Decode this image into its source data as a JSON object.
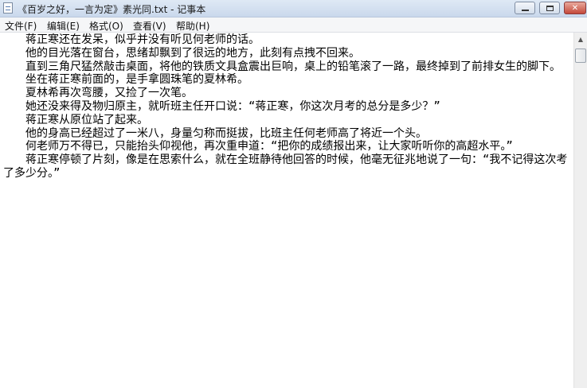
{
  "window": {
    "title": "《百岁之好，一言为定》素光同.txt - 记事本"
  },
  "menubar": {
    "items": [
      {
        "label": "文件(F)"
      },
      {
        "label": "编辑(E)"
      },
      {
        "label": "格式(O)"
      },
      {
        "label": "查看(V)"
      },
      {
        "label": "帮助(H)"
      }
    ]
  },
  "editor": {
    "content": "　　蒋正寒还在发呆，似乎并没有听见何老师的话。\n　　他的目光落在窗台，思绪却飘到了很远的地方，此刻有点拽不回来。\n　　直到三角尺猛然敲击桌面，将他的铁质文具盒震出巨响，桌上的铅笔滚了一路，最终掉到了前排女生的脚下。\n　　坐在蒋正寒前面的，是手拿圆珠笔的夏林希。\n　　夏林希再次弯腰，又捡了一次笔。\n　　她还没来得及物归原主，就听班主任开口说：“蒋正寒，你这次月考的总分是多少？”\n　　蒋正寒从原位站了起来。\n　　他的身高已经超过了一米八，身量匀称而挺拔，比班主任何老师高了将近一个头。\n　　何老师万不得已，只能抬头仰视他，再次重申道：“把你的成绩报出来，让大家听听你的高超水平。”\n　　蒋正寒停顿了片刻，像是在思索什么，就在全班静待他回答的时候，他毫无征兆地说了一句：“我不记得这次考了多少分。”"
  },
  "icons": {
    "app": "notepad-icon",
    "minimize": "minimize-icon",
    "maximize": "maximize-icon",
    "close": "close-icon",
    "scroll_up": "scroll-up-arrow-icon"
  }
}
